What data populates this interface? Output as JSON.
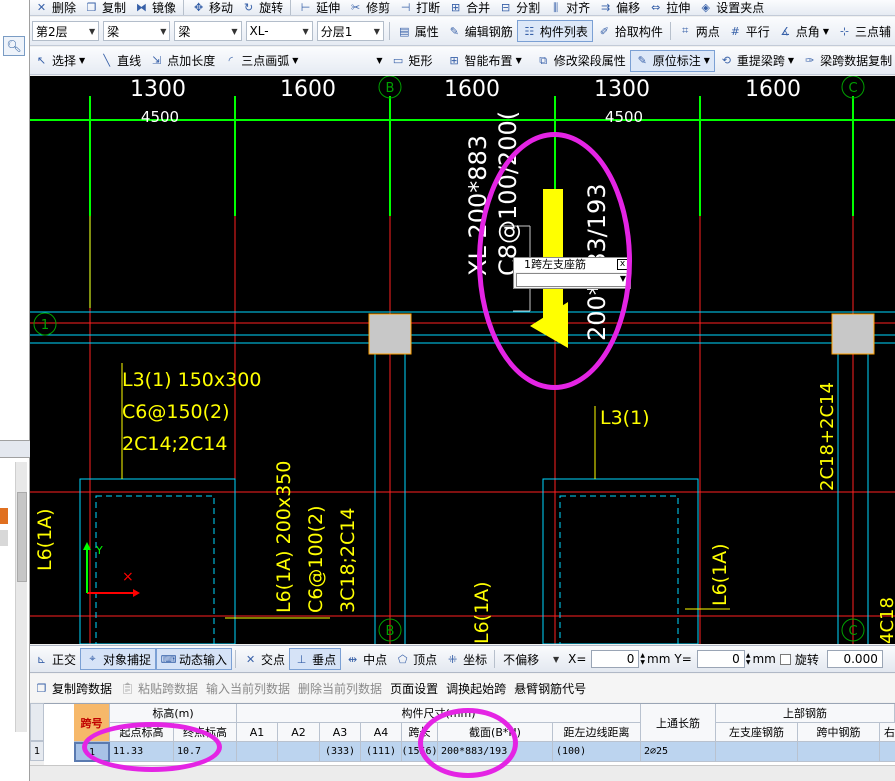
{
  "toolbar_top": {
    "items": [
      "删除",
      "复制",
      "镜像",
      "移动",
      "旋转",
      "延伸",
      "修剪",
      "打断",
      "合并",
      "分割",
      "对齐",
      "偏移",
      "拉伸",
      "设置夹点"
    ]
  },
  "toolbar_row1": {
    "floor": "第2层",
    "category": "梁",
    "type": "梁",
    "component": "XL-",
    "layer": "分层1",
    "buttons": {
      "property": "属性",
      "edit_rebar": "编辑钢筋",
      "component_list": "构件列表",
      "pick_component": "拾取构件",
      "two_points": "两点",
      "parallel": "平行",
      "point_angle": "点角",
      "three_point_axis": "三点辅"
    }
  },
  "toolbar_row2": {
    "select": "选择",
    "line": "直线",
    "point_extend": "点加长度",
    "three_point_arc": "三点画弧",
    "rect": "矩形",
    "smart_layout": "智能布置",
    "modify_span_props": "修改梁段属性",
    "original_annotation": "原位标注",
    "re_extract_span": "重提梁跨",
    "span_data_copy": "梁跨数据复制"
  },
  "canvas": {
    "dims_top": [
      "1300",
      "1600",
      "1600",
      "1300",
      "1600"
    ],
    "dims_total": [
      "4500",
      "4500"
    ],
    "axis_labels": [
      "B",
      "C",
      "1",
      "B",
      "C"
    ],
    "beam_label_vertical_1": "XL 200*883",
    "beam_label_vertical_2": "C8@100/200(",
    "beam_label_vertical_3": "200*883/193",
    "l3_main": [
      "L3(1) 150x300",
      "C6@150(2)",
      "2C14;2C14"
    ],
    "l3_small": "L3(1)",
    "l6_left": "L6(1A)",
    "l6_mid": [
      "L6(1A) 200x350",
      "C6@100(2)",
      "3C18;2C14"
    ],
    "l6_bottom": "L6(1A)",
    "l6_right": "L6(1A)",
    "right_rebar": "2C18+2C14",
    "right_bottom": "4C18",
    "popup_title": "1跨左支座筋",
    "popup_close": "x",
    "popup_value": "",
    "ucs_y": "Y"
  },
  "snapbar": {
    "orthogonal": "正交",
    "object_snap": "对象捕捉",
    "dynamic_input": "动态输入",
    "intersection": "交点",
    "perpendicular": "垂点",
    "midpoint": "中点",
    "vertex": "顶点",
    "coordinate": "坐标",
    "offset_mode": "不偏移",
    "x_label": "X=",
    "x_value": "0",
    "y_label": "Y=",
    "y_value": "0",
    "unit": "mm",
    "rotate": "旋转",
    "rotate_value": "0.000"
  },
  "table_toolbar": {
    "copy_span": "复制跨数据",
    "paste_span": "粘贴跨数据",
    "input_current_col": "输入当前列数据",
    "delete_current_col": "删除当前列数据",
    "page_setup": "页面设置",
    "swap_start_span": "调换起始跨",
    "cantilever_code": "悬臂钢筋代号"
  },
  "table": {
    "headers": {
      "span_no": "跨号",
      "elevation_group": "标高(m)",
      "start_elev": "起点标高",
      "end_elev": "终点标高",
      "dims_group": "构件尺寸(mm)",
      "a1": "A1",
      "a2": "A2",
      "a3": "A3",
      "a4": "A4",
      "span_len": "跨长",
      "section": "截面(B*H)",
      "dist_left_edge": "距左边线距离",
      "top_through": "上通长筋",
      "top_rebar_group": "上部钢筋",
      "left_support": "左支座钢筋",
      "mid_span": "跨中钢筋",
      "right_support": "右"
    },
    "rows": [
      {
        "row_no": "1",
        "span_no": "1",
        "start_elev": "11.33",
        "end_elev": "10.7",
        "a1": "",
        "a2": "",
        "a3": "(333)",
        "a4": "(111)",
        "span_len": "(1556)",
        "section": "200*883/193",
        "dist_left_edge": "(100)",
        "top_through": "2⌀25",
        "left_support": "",
        "mid_span": "",
        "right_support": ""
      }
    ]
  },
  "colors": {
    "annotation_ellipse": "#e424e4",
    "canvas_bg": "#000000",
    "dim_white": "#ffffff",
    "cad_yellow": "#ffff00",
    "axis_green": "#00ff00",
    "axis_red": "#ff0000",
    "cyan": "#00d8ff"
  }
}
